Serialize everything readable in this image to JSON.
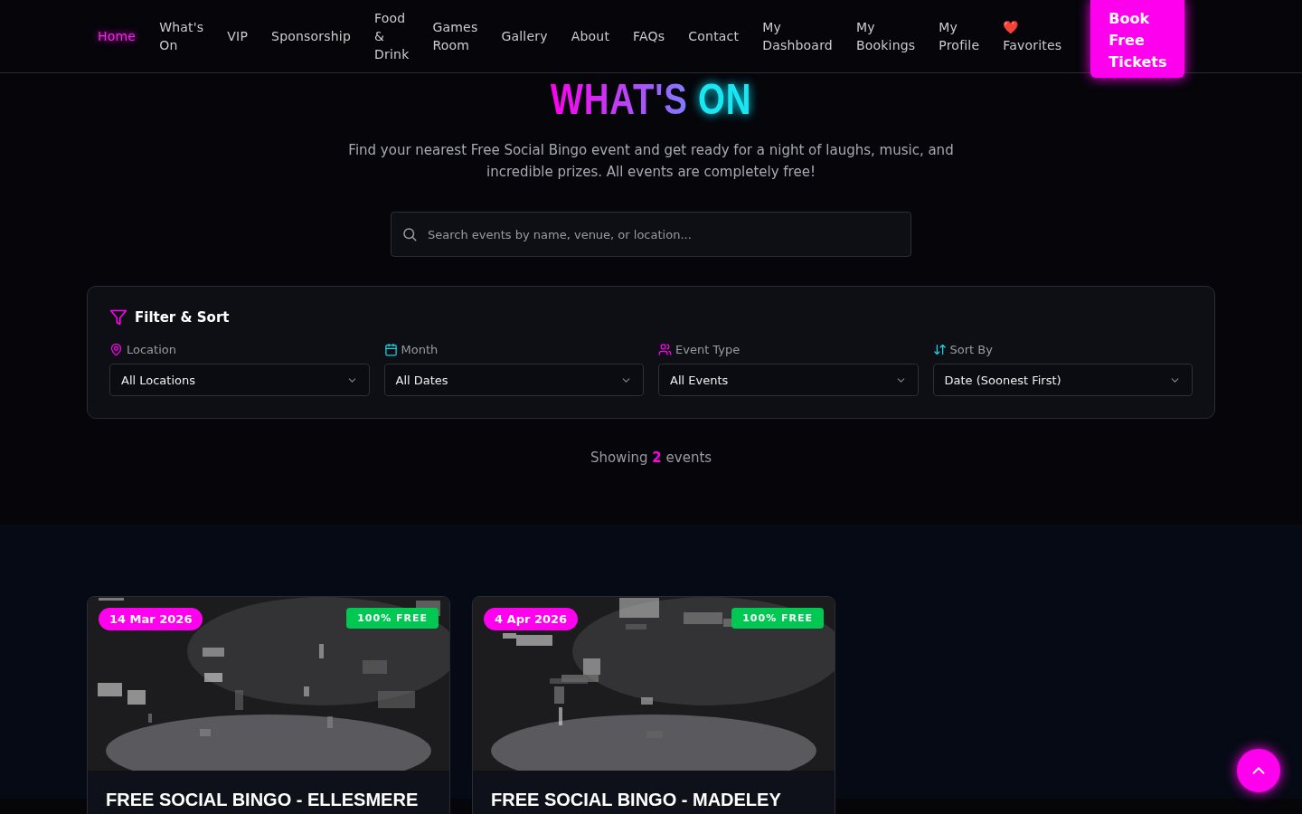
{
  "nav": {
    "items": [
      {
        "label": "Home",
        "selected": true
      },
      {
        "label": "What's On",
        "selected": false
      },
      {
        "label": "VIP",
        "selected": false
      },
      {
        "label": "Sponsorship",
        "selected": false
      },
      {
        "label": "Food & Drink",
        "selected": false
      },
      {
        "label": "Games Room",
        "selected": false
      },
      {
        "label": "Gallery",
        "selected": false
      },
      {
        "label": "About",
        "selected": false
      },
      {
        "label": "FAQs",
        "selected": false
      },
      {
        "label": "Contact",
        "selected": false
      },
      {
        "label": "My Dashboard",
        "selected": false
      },
      {
        "label": "My Bookings",
        "selected": false
      },
      {
        "label": "My Profile",
        "selected": false
      },
      {
        "label": "❤️ Favorites",
        "selected": false
      }
    ],
    "cta": "Book Free Tickets"
  },
  "hero": {
    "title_start": "WHAT'S",
    "title_end": "ON",
    "subtitle": "Find your nearest Free Social Bingo event and get ready for a night of laughs, music, and incredible prizes. All events are completely free!",
    "search": {
      "placeholder": "Search events by name, venue, or location..."
    }
  },
  "filters": {
    "title": "Filter & Sort",
    "fields": [
      {
        "kind": "location",
        "label": "Location",
        "value": "All Locations"
      },
      {
        "kind": "month",
        "label": "Month",
        "value": "All Dates"
      },
      {
        "kind": "people",
        "label": "Event Type",
        "value": "All Events"
      },
      {
        "kind": "sort",
        "label": "Sort By",
        "value": "Date (Soonest First)"
      }
    ]
  },
  "results": {
    "prefix": "Showing",
    "count": "2",
    "suffix": "events"
  },
  "events": [
    {
      "date": "14 Mar 2026",
      "badge": "100% FREE",
      "title": "FREE SOCIAL BINGO - ELLESMERE"
    },
    {
      "date": "4 Apr 2026",
      "badge": "100% FREE",
      "title": "FREE SOCIAL BINGO - MADELEY"
    }
  ]
}
